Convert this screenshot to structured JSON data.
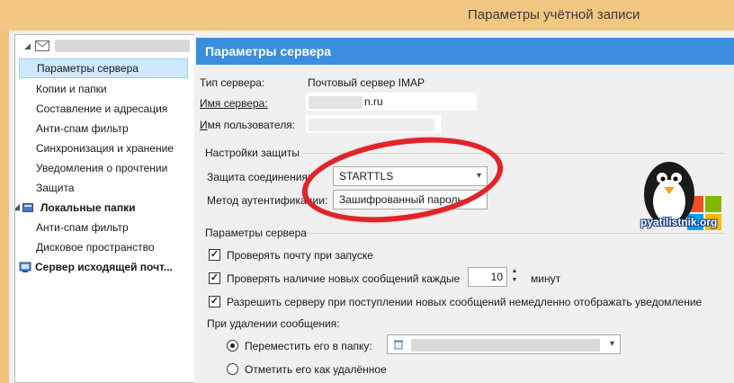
{
  "window": {
    "title": "Параметры учётной записи"
  },
  "sidebar": {
    "account_label": "",
    "items": [
      {
        "label": "Параметры сервера"
      },
      {
        "label": "Копии и папки"
      },
      {
        "label": "Составление и адресация"
      },
      {
        "label": "Анти-спам фильтр"
      },
      {
        "label": "Синхронизация и хранение"
      },
      {
        "label": "Уведомления о прочтении"
      },
      {
        "label": "Защита"
      },
      {
        "label": "Локальные папки"
      },
      {
        "label": "Анти-спам фильтр"
      },
      {
        "label": "Дисковое пространство"
      },
      {
        "label": "Сервер исходящей почт..."
      }
    ]
  },
  "main": {
    "header": "Параметры сервера",
    "server_type_label": "Тип сервера:",
    "server_type_value": "Почтовый сервер IMAP",
    "server_name_label": "Имя сервера:",
    "server_name_value": "n.ru",
    "user_name_label": "Имя пользователя:",
    "security": {
      "title": "Настройки защиты",
      "connection_label": "Защита соединения:",
      "connection_value": "STARTTLS",
      "auth_label": "Метод аутентификации:",
      "auth_value": "Зашифрованный пароль"
    },
    "server_settings": {
      "title": "Параметры сервера",
      "check_on_start": "Проверять почту при запуске",
      "check_every_label": "Проверять наличие новых сообщений каждые",
      "check_every_value": "10",
      "minutes_label": "минут",
      "allow_push": "Разрешить серверу при поступлении новых сообщений немедленно отображать уведомление",
      "on_delete_label": "При удалении сообщения:",
      "move_to_folder": "Переместить его в папку:",
      "mark_deleted": "Отметить его как удалённое"
    }
  },
  "logo": {
    "text": "pyatilistnik.org"
  },
  "colors": {
    "header_bg": "#3b8ede",
    "selection": "#cde8ff",
    "annotation": "#e0242a"
  }
}
